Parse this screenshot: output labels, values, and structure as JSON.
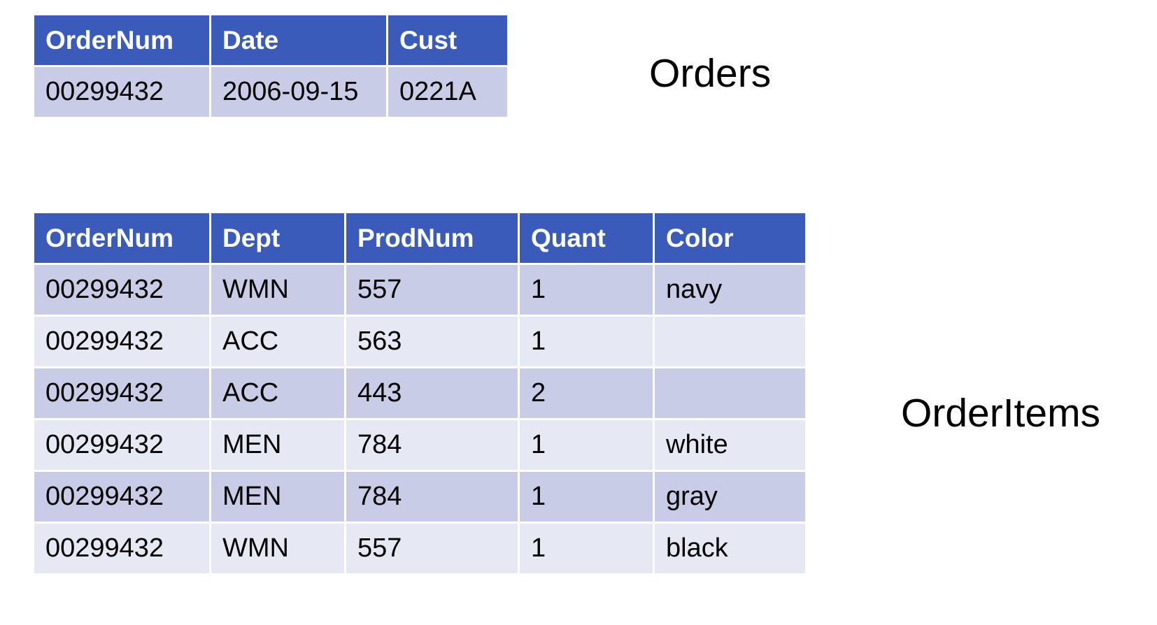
{
  "orders": {
    "caption": "Orders",
    "columns": [
      "OrderNum",
      "Date",
      "Cust"
    ],
    "rows": [
      [
        "00299432",
        "2006-09-15",
        "0221A"
      ]
    ]
  },
  "order_items": {
    "caption": "OrderItems",
    "columns": [
      "OrderNum",
      "Dept",
      "ProdNum",
      "Quant",
      "Color"
    ],
    "rows": [
      [
        "00299432",
        "WMN",
        "557",
        "1",
        "navy"
      ],
      [
        "00299432",
        "ACC",
        "563",
        "1",
        ""
      ],
      [
        "00299432",
        "ACC",
        "443",
        "2",
        ""
      ],
      [
        "00299432",
        "MEN",
        "784",
        "1",
        "white"
      ],
      [
        "00299432",
        "MEN",
        "784",
        "1",
        "gray"
      ],
      [
        "00299432",
        "WMN",
        "557",
        "1",
        "black"
      ]
    ]
  },
  "colors": {
    "header_bg": "#3a5bba",
    "row_dark": "#c8cce6",
    "row_light": "#e6e8f3"
  }
}
